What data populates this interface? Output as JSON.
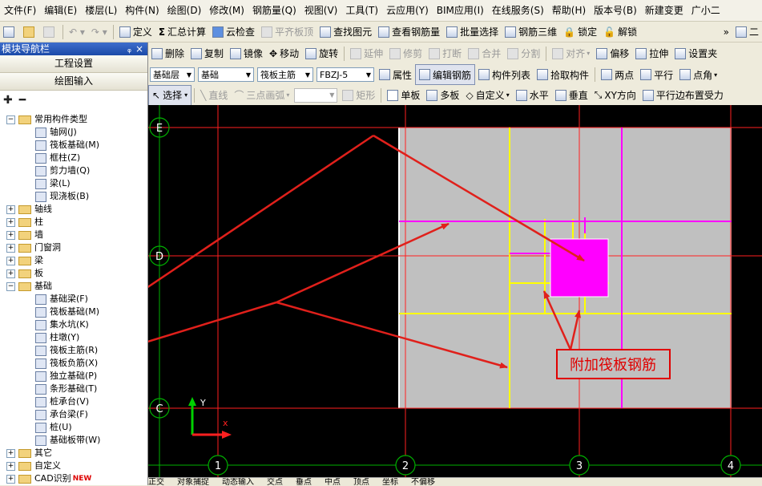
{
  "menu": [
    "文件(F)",
    "编辑(E)",
    "楼层(L)",
    "构件(N)",
    "绘图(D)",
    "修改(M)",
    "钢筋量(Q)",
    "视图(V)",
    "工具(T)",
    "云应用(Y)",
    "BIM应用(I)",
    "在线服务(S)",
    "帮助(H)",
    "版本号(B)",
    "新建变更",
    "广小二"
  ],
  "toolbar1": [
    "定义",
    "汇总计算",
    "云检查",
    "平齐板顶",
    "查找图元",
    "查看钢筋量",
    "批量选择",
    "钢筋三维",
    "锁定",
    "解锁"
  ],
  "toolbar1_right": "二",
  "sidebar": {
    "title": "模块导航栏",
    "pin": "ᵩ",
    "close": "×",
    "buttons": [
      "工程设置",
      "绘图输入"
    ],
    "tree": [
      {
        "level": 0,
        "expanded": true,
        "label": "常用构件类型",
        "kind": "folder"
      },
      {
        "level": 1,
        "label": "轴网(J)"
      },
      {
        "level": 1,
        "label": "筏板基础(M)"
      },
      {
        "level": 1,
        "label": "框柱(Z)"
      },
      {
        "level": 1,
        "label": "剪力墙(Q)"
      },
      {
        "level": 1,
        "label": "梁(L)"
      },
      {
        "level": 1,
        "label": "现浇板(B)"
      },
      {
        "level": 0,
        "expanded": false,
        "label": "轴线",
        "kind": "folder"
      },
      {
        "level": 0,
        "expanded": false,
        "label": "柱",
        "kind": "folder"
      },
      {
        "level": 0,
        "expanded": false,
        "label": "墙",
        "kind": "folder"
      },
      {
        "level": 0,
        "expanded": false,
        "label": "门窗洞",
        "kind": "folder"
      },
      {
        "level": 0,
        "expanded": false,
        "label": "梁",
        "kind": "folder"
      },
      {
        "level": 0,
        "expanded": false,
        "label": "板",
        "kind": "folder"
      },
      {
        "level": 0,
        "expanded": true,
        "label": "基础",
        "kind": "folder"
      },
      {
        "level": 1,
        "label": "基础梁(F)"
      },
      {
        "level": 1,
        "label": "筏板基础(M)"
      },
      {
        "level": 1,
        "label": "集水坑(K)"
      },
      {
        "level": 1,
        "label": "柱墩(Y)"
      },
      {
        "level": 1,
        "label": "筏板主筋(R)"
      },
      {
        "level": 1,
        "label": "筏板负筋(X)"
      },
      {
        "level": 1,
        "label": "独立基础(P)"
      },
      {
        "level": 1,
        "label": "条形基础(T)"
      },
      {
        "level": 1,
        "label": "桩承台(V)"
      },
      {
        "level": 1,
        "label": "承台梁(F)"
      },
      {
        "level": 1,
        "label": "桩(U)"
      },
      {
        "level": 1,
        "label": "基础板带(W)"
      },
      {
        "level": 0,
        "expanded": false,
        "label": "其它",
        "kind": "folder"
      },
      {
        "level": 0,
        "expanded": false,
        "label": "自定义",
        "kind": "folder"
      },
      {
        "level": 0,
        "expanded": false,
        "label": "CAD识别",
        "kind": "folder",
        "badge": "NEW"
      }
    ]
  },
  "toolbar2": [
    "删除",
    "复制",
    "镜像",
    "移动",
    "旋转",
    "延伸",
    "修剪",
    "打断",
    "合并",
    "分割",
    "对齐",
    "偏移",
    "拉伸",
    "设置夹"
  ],
  "toolbar3": {
    "floor": "基础层",
    "category": "基础",
    "type": "筏板主筋",
    "name": "FBZJ-5",
    "buttons": [
      "属性",
      "编辑钢筋",
      "构件列表",
      "拾取构件",
      "两点",
      "平行",
      "点角"
    ]
  },
  "toolbar4": {
    "select": "选择",
    "buttons": [
      "直线",
      "三点画弧",
      "矩形",
      "单板",
      "多板",
      "自定义",
      "水平",
      "垂直",
      "XY方向",
      "平行边布置受力"
    ]
  },
  "canvas": {
    "axis_rows": [
      "E",
      "D",
      "C"
    ],
    "axis_cols": [
      "1",
      "2",
      "3",
      "4"
    ],
    "annotation": "附加筏板钢筋",
    "ucs_y": "Y",
    "ucs_x": "x"
  },
  "statusbar": [
    "正交",
    "对象捕捉",
    "动态输入",
    "交点",
    "垂点",
    "中点",
    "顶点",
    "坐标",
    "不偏移"
  ],
  "colors": {
    "canvas_bg": "#000000",
    "slab_gray": "#c0c0c0",
    "axis_red": "#ff2020",
    "axis_label_green": "#00b000",
    "rebar_yellow": "#ffff00",
    "rebar_magenta": "#ff00ff",
    "arrow_red": "#e0201b",
    "note_red": "#e00000"
  }
}
